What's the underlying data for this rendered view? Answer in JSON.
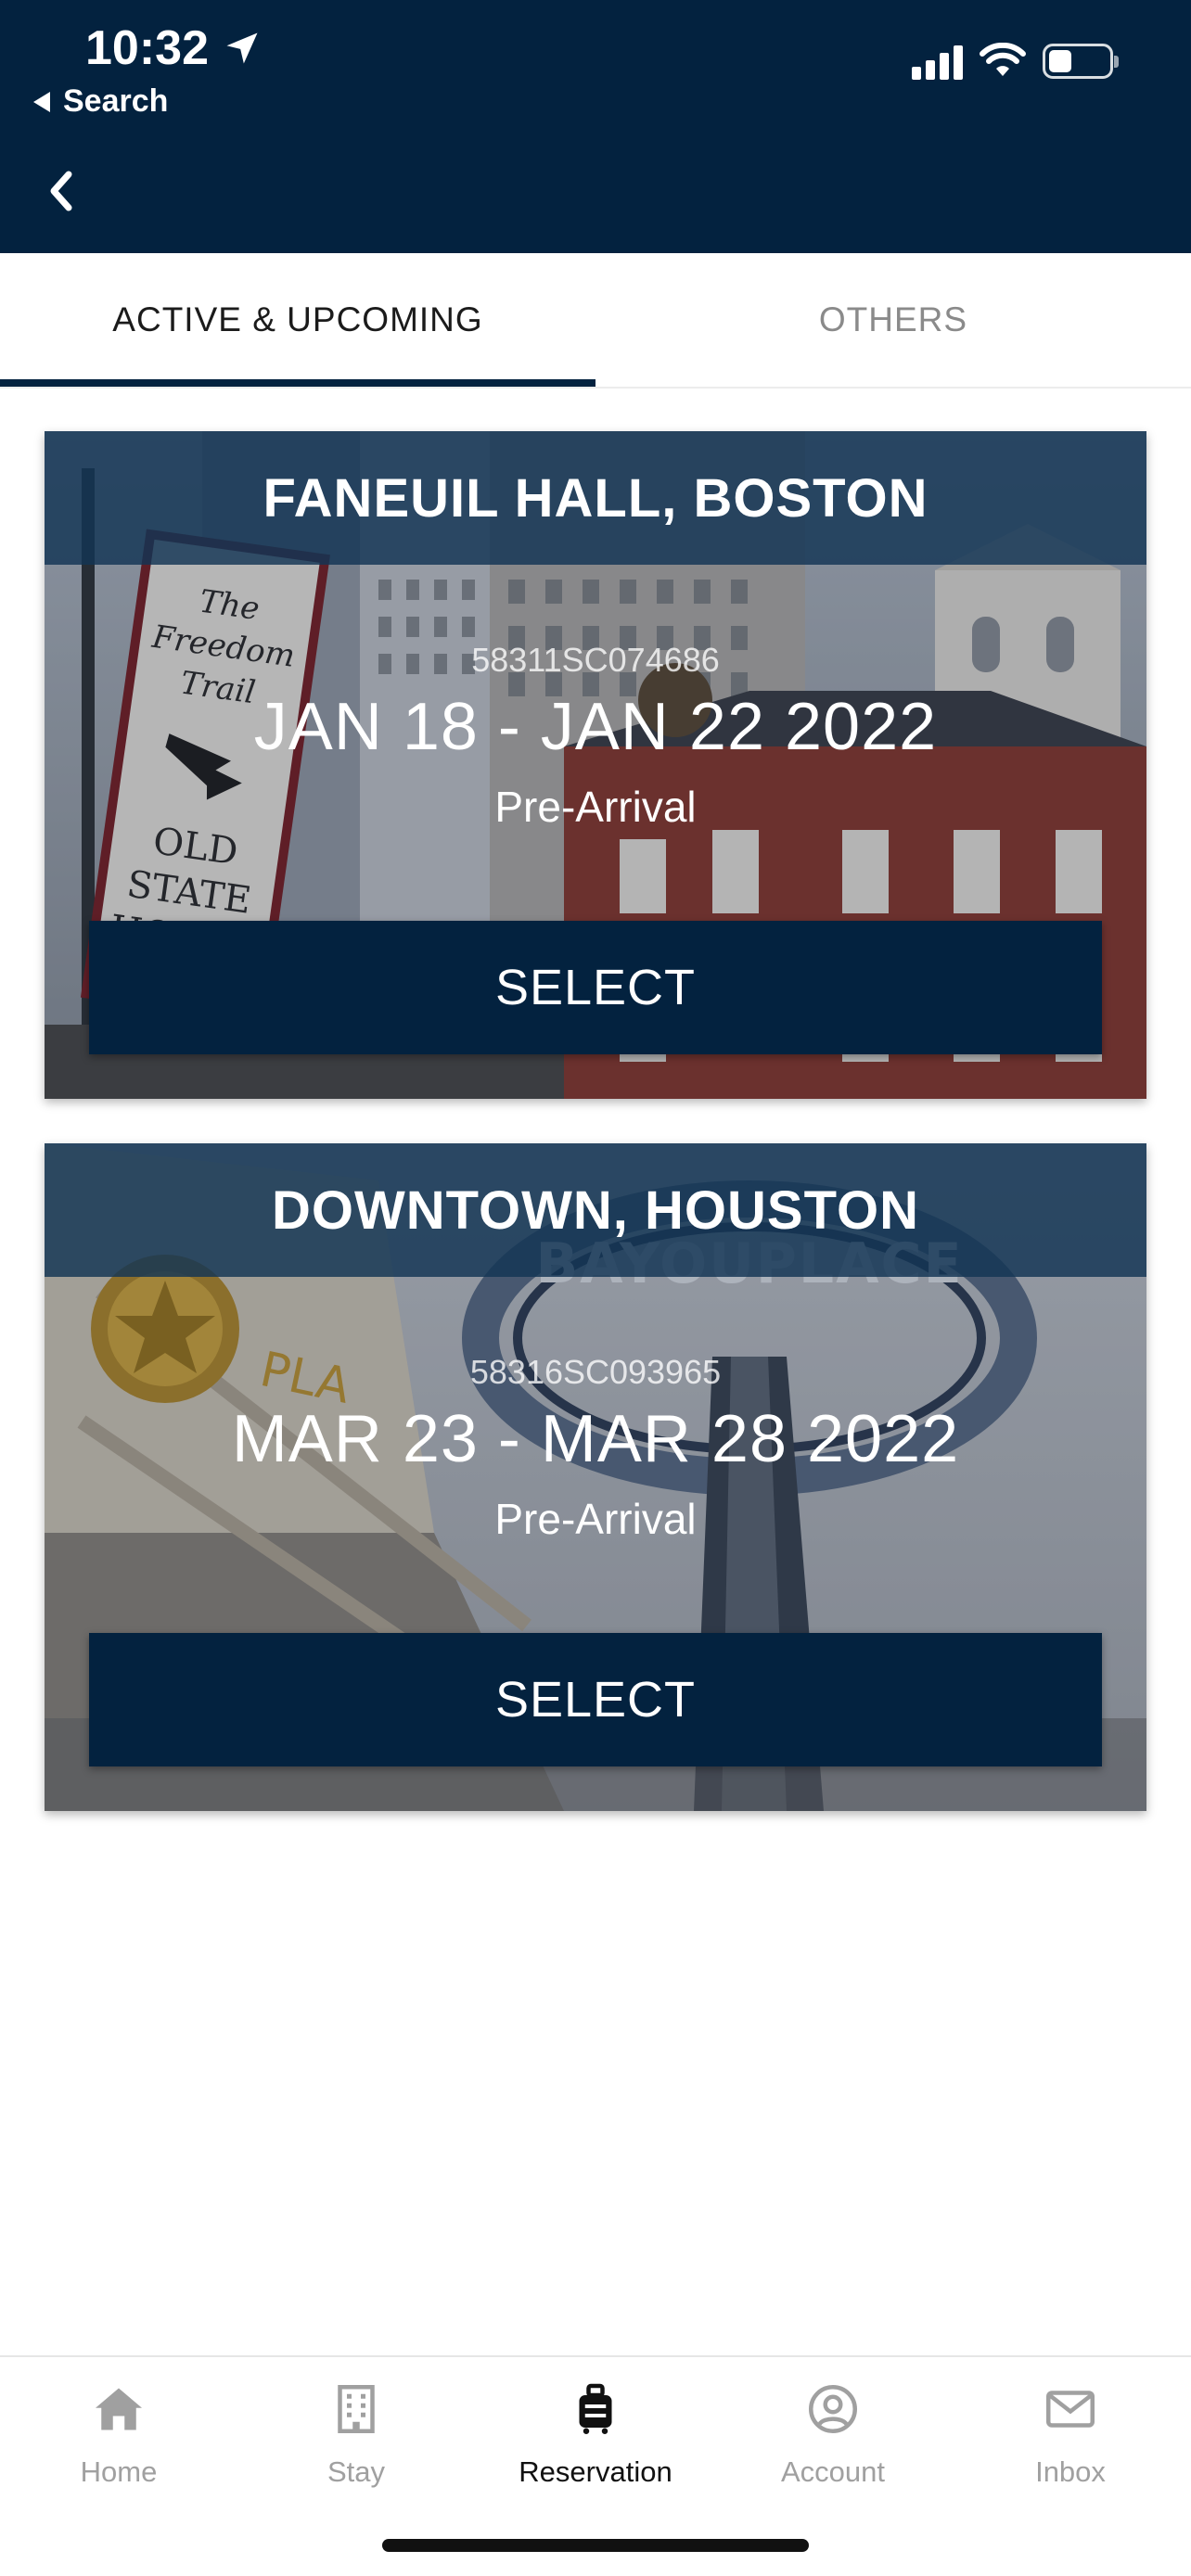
{
  "status_bar": {
    "time": "10:32",
    "back_app_label": "Search"
  },
  "tabs": [
    {
      "label": "ACTIVE & UPCOMING",
      "active": true
    },
    {
      "label": "OTHERS",
      "active": false
    }
  ],
  "reservations": [
    {
      "location": "FANEUIL HALL, BOSTON",
      "confirmation": "58311SC074686",
      "dates": "JAN 18 - JAN 22 2022",
      "status": "Pre-Arrival",
      "action_label": "SELECT",
      "sign_lines": [
        "The",
        "Freedom",
        "Trail",
        "OLD",
        "STATE",
        "HOUSE"
      ]
    },
    {
      "location": "DOWNTOWN, HOUSTON",
      "confirmation": "58316SC093965",
      "dates": "MAR 23 - MAR 28 2022",
      "status": "Pre-Arrival",
      "action_label": "SELECT",
      "sign_text": "BAYOUPLACE"
    }
  ],
  "bottom_nav": [
    {
      "label": "Home",
      "icon": "home-icon",
      "active": false
    },
    {
      "label": "Stay",
      "icon": "building-icon",
      "active": false
    },
    {
      "label": "Reservation",
      "icon": "luggage-icon",
      "active": true
    },
    {
      "label": "Account",
      "icon": "account-icon",
      "active": false
    },
    {
      "label": "Inbox",
      "icon": "mail-icon",
      "active": false
    }
  ],
  "colors": {
    "header_bg": "#03223f",
    "button_bg": "#03223f",
    "active_text": "#111111",
    "inactive_text": "#a0a0a0"
  }
}
